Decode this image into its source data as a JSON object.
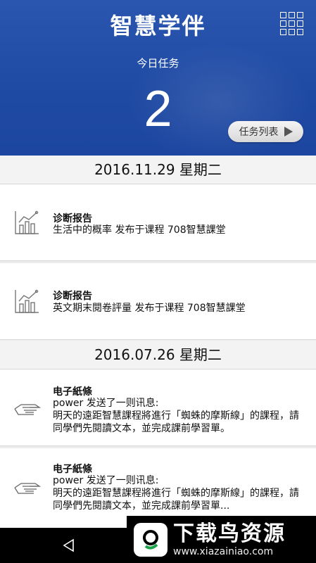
{
  "header": {
    "app_title": "智慧学伴",
    "today_label": "今日任务",
    "today_count": "2",
    "task_list_button": "任务列表"
  },
  "sections": [
    {
      "date": "2016.11.29 星期二",
      "items": [
        {
          "icon": "bar-chart-icon",
          "title": "诊断报告",
          "desc": "生活中的概率 发布于课程 708智慧課堂"
        },
        {
          "icon": "bar-chart-icon",
          "title": "诊断报告",
          "desc": "英文期末閱卷評量 发布于课程 708智慧課堂"
        }
      ]
    },
    {
      "date": "2016.07.26 星期二",
      "items": [
        {
          "icon": "hand-note-icon",
          "title": "电子紙條",
          "desc": "power 发送了一则讯息:\n明天的遠距智慧課程將進行「蜘蛛的摩斯線」的課程，請同學們先閱讀文本，並完成課前學習單。"
        },
        {
          "icon": "hand-note-icon",
          "title": "电子紙條",
          "desc": "power 发送了一则讯息:\n明天的遠距智慧課程將進行「蜘蛛的摩斯線」的課程，請同學們先閱讀文本，並完成課前學習單..."
        }
      ]
    }
  ],
  "watermark": {
    "main": "下载鸟资源",
    "url": "www.xiazainiao.com"
  },
  "colors": {
    "header_blue": "#1f4aa3",
    "background": "#ececec"
  }
}
